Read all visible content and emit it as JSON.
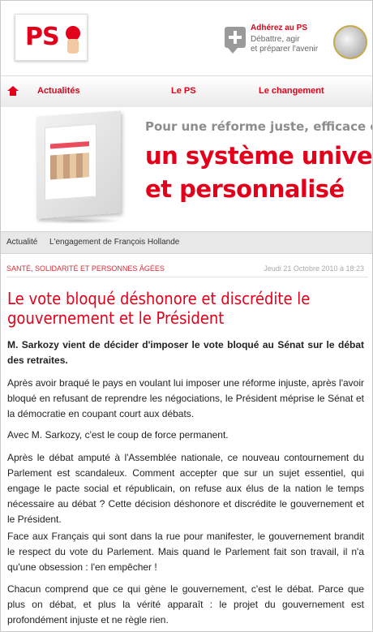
{
  "header": {
    "logo_text": "PS",
    "join_title": "Adhérez au PS",
    "join_subtitle": "Débattre, agir\net préparer l'avenir"
  },
  "nav": {
    "items": [
      "Actualités",
      "Le PS",
      "Le changement"
    ]
  },
  "banner": {
    "line1": "Pour une réforme juste, efficace e",
    "line2": "un système univer",
    "line3": "et personnalisé"
  },
  "breadcrumb": [
    "Actualité",
    "L'engagement de François Hollande"
  ],
  "article": {
    "category": "Santé, solidarité et personnes âgées",
    "date": "Jeudi 21 Octobre 2010 à 18:23",
    "title_lines": [
      "Le vote bloqué déshonore et discrédite le",
      "gouvernement et le Président"
    ],
    "lead": "M. Sarkozy vient de décider d'imposer le vote bloqué au Sénat sur le débat des retraites.",
    "paragraphs": [
      "Après avoir braqué le pays en voulant lui imposer une réforme injuste, après l'avoir bloqué en refusant de reprendre les négociations, le Président méprise le Sénat et la démocratie en coupant court aux débats.",
      "Avec M. Sarkozy, c'est le coup de force permanent.",
      "Après le débat amputé à l'Assemblée nationale, ce nouveau contournement du Parlement est scandaleux. Comment accepter que sur un sujet essentiel, qui engage le pacte social et républicain, on refuse aux élus de la nation le temps nécessaire au débat ? Cette décision déshonore et discrédite le gouvernement et le Président.",
      "Face aux Français qui sont dans la rue pour manifester, le gouvernement brandit le respect du vote du Parlement. Mais quand le Parlement fait son travail, il n'a qu'une obsession : l'en empêcher !",
      "Chacun comprend que ce qui gène le gouvernement, c'est le débat. Parce que plus on débat, et plus la vérité apparaît : le projet du gouvernement est profondément injuste et ne règle rien."
    ]
  },
  "colors": {
    "brand_red": "#e2001a",
    "category_red": "#d52d36",
    "nav_bg": "#ececec",
    "breadcrumb_bg": "#e8e8e8"
  },
  "icons": [
    "home-icon",
    "add-icon",
    "euro-coin-icon",
    "rose-fist-logo"
  ]
}
